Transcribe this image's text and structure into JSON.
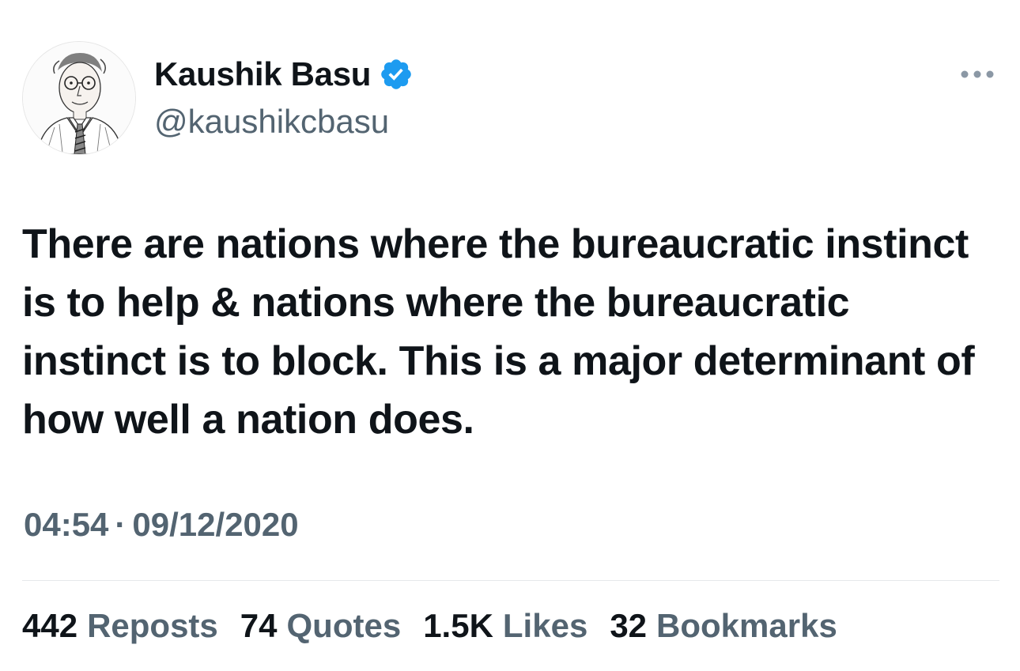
{
  "author": {
    "display_name": "Kaushik Basu",
    "handle": "@kaushikcbasu",
    "verified": true,
    "verified_color": "#1d9bf0"
  },
  "tweet": {
    "text": "There are nations where the bureaucratic instinct is to help & nations where the bureaucratic instinct is to block. This is a major determinant of how well a nation does.",
    "time": "04:54",
    "separator": "·",
    "date": "09/12/2020"
  },
  "stats": [
    {
      "count": "442",
      "label": "Reposts"
    },
    {
      "count": "74",
      "label": "Quotes"
    },
    {
      "count": "1.5K",
      "label": "Likes"
    },
    {
      "count": "32",
      "label": "Bookmarks"
    }
  ],
  "colors": {
    "text_primary": "#0f1419",
    "text_secondary": "#536471",
    "divider": "#e6e9eb"
  },
  "icons": {
    "verified": "verified-badge-icon",
    "more": "more-options-icon"
  }
}
